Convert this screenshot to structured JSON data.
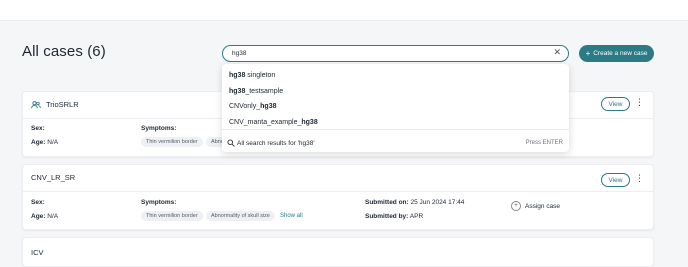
{
  "header": {
    "title": "All cases (6)"
  },
  "create_button": {
    "icon": "plus-icon",
    "label": "Create a new case"
  },
  "search": {
    "value": "hg38",
    "clear_icon": "close-icon"
  },
  "dropdown": {
    "suggestions": [
      {
        "bold": "hg38",
        "rest": " singleton"
      },
      {
        "bold": "hg38",
        "rest": "_testsample"
      },
      {
        "pre": "CNVonly_",
        "bold": "hg38"
      },
      {
        "pre": "CNV_manta_example_",
        "bold": "hg38"
      }
    ],
    "all_results": "All search results for 'hg38'",
    "press_enter": "Press ENTER"
  },
  "cases": [
    {
      "name": "TrioSRLR",
      "icon": "group-icon",
      "sex_label": "Sex:",
      "age_label": "Age:",
      "age_value": "N/A",
      "symptoms_label": "Symptoms:",
      "chips": [
        "Thin vermilion border",
        "Abno"
      ],
      "view_label": "View"
    },
    {
      "name": "CNV_LR_SR",
      "sex_label": "Sex:",
      "age_label": "Age:",
      "age_value": "N/A",
      "symptoms_label": "Symptoms:",
      "chips": [
        "Thin vermilion border",
        "Abnormality of skull size"
      ],
      "show_all": "Show all",
      "submitted_on_label": "Submitted on:",
      "submitted_on_value": "25 Jun 2024 17:44",
      "submitted_by_label": "Submitted by:",
      "submitted_by_value": "APR",
      "assign_label": "Assign case",
      "view_label": "View"
    },
    {
      "name": "ICV"
    }
  ],
  "colors": {
    "accent": "#2b7a85",
    "background": "#f5f6f8"
  }
}
